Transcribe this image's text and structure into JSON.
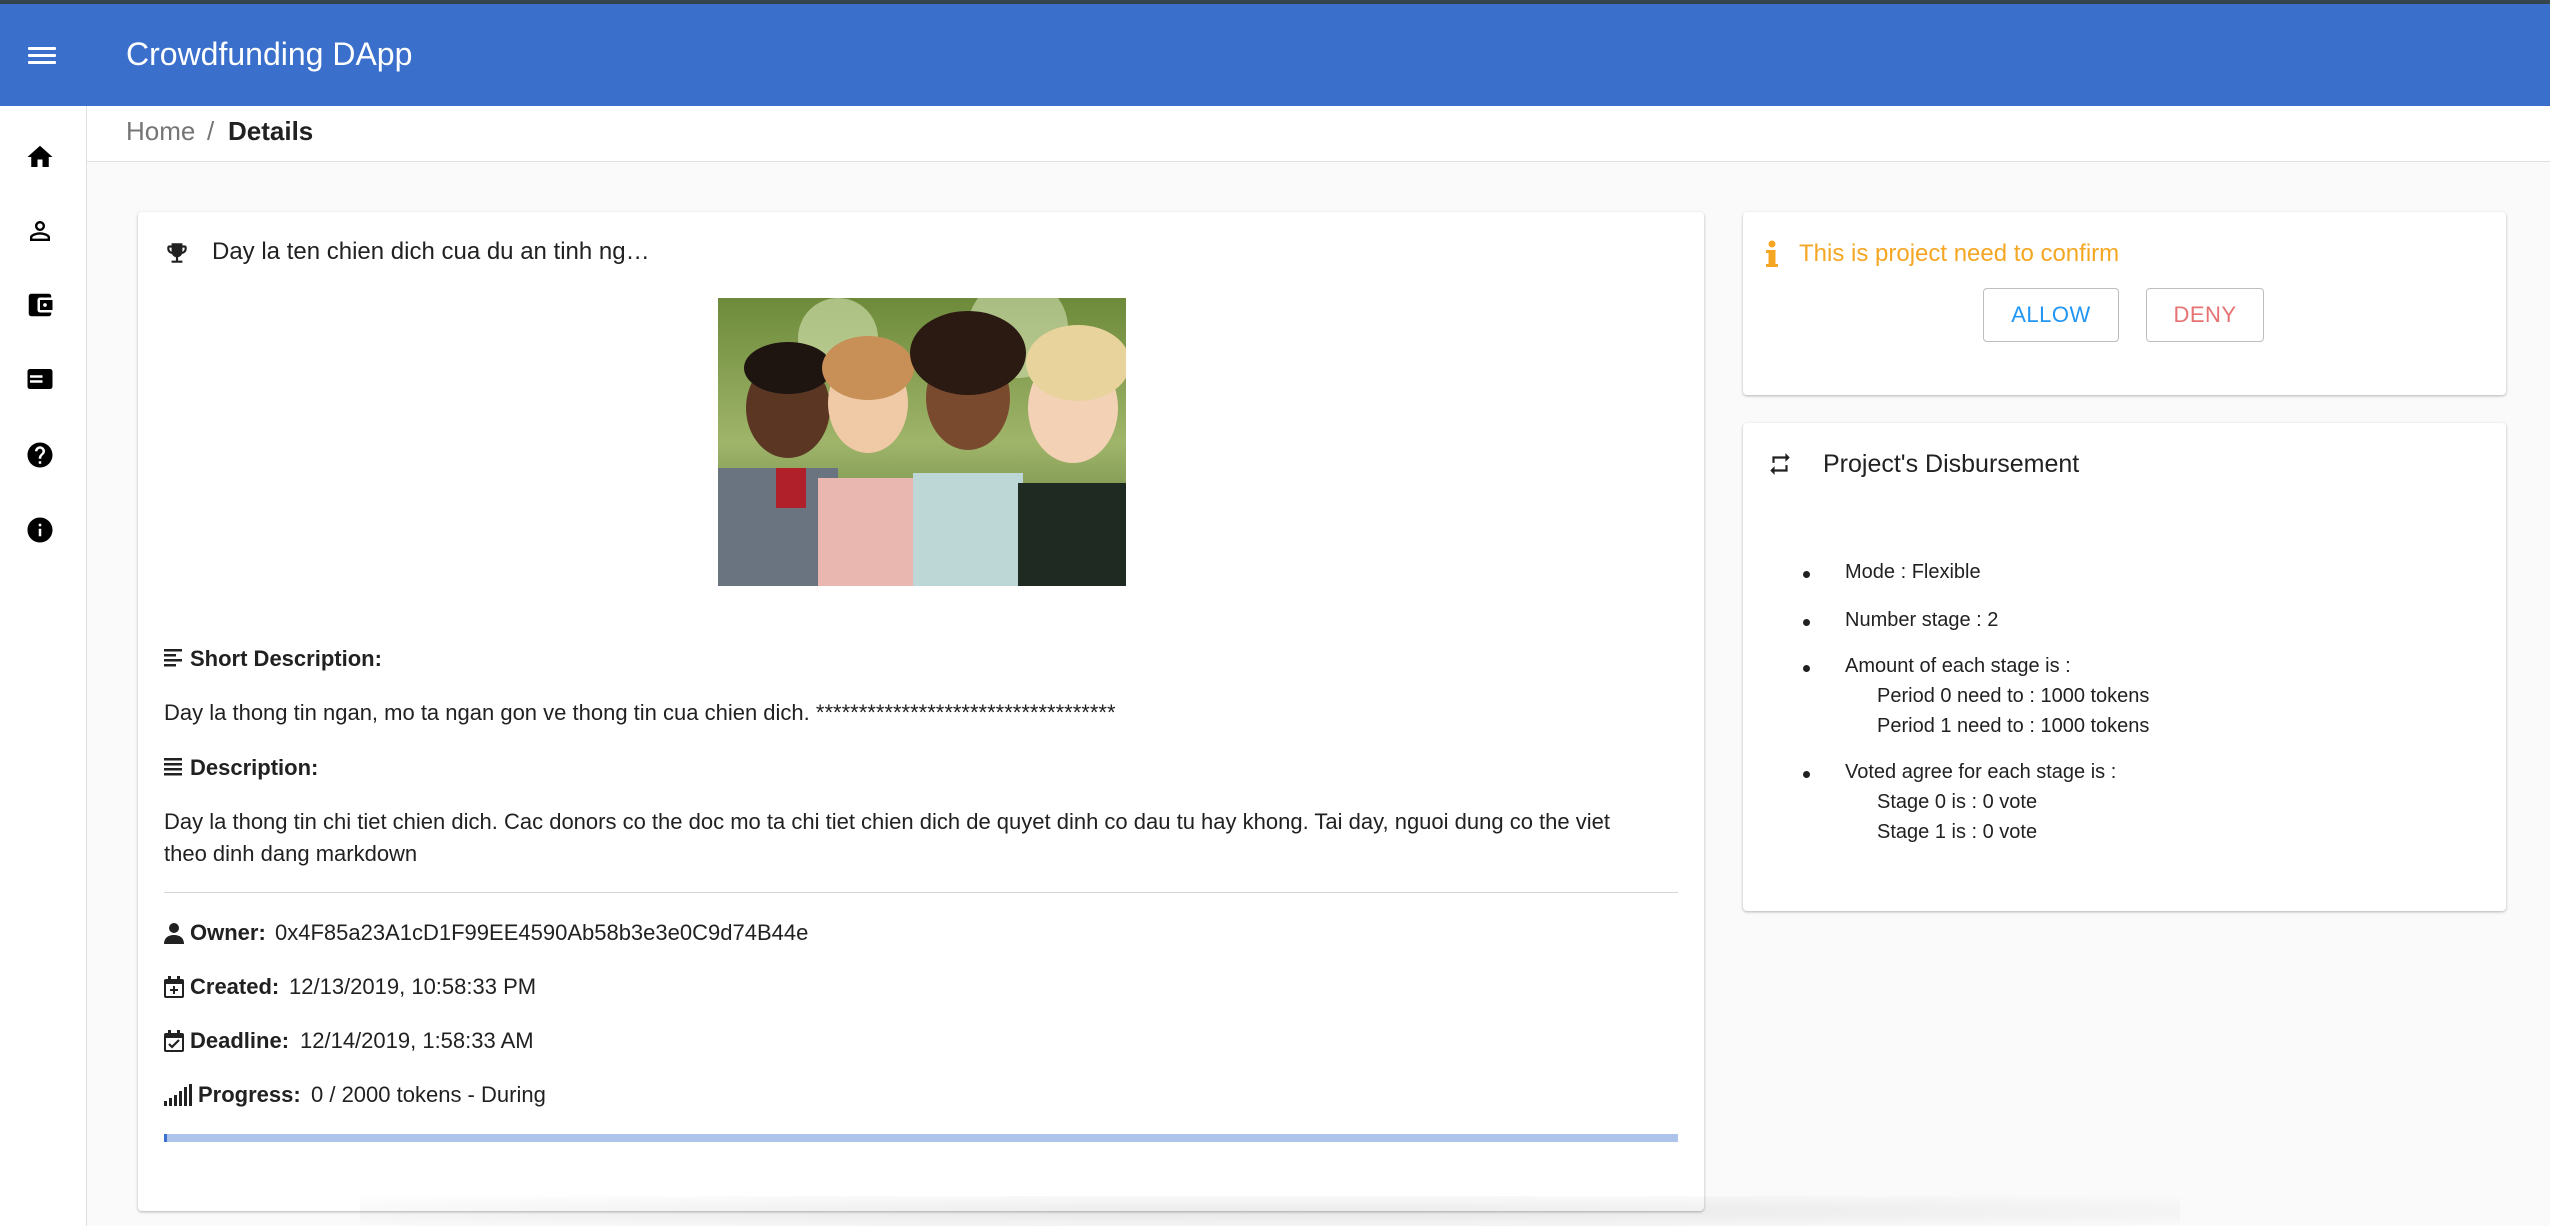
{
  "app": {
    "title": "Crowdfunding DApp"
  },
  "sidebar": {
    "items": [
      {
        "icon": "home-icon"
      },
      {
        "icon": "person-icon"
      },
      {
        "icon": "wallet-icon"
      },
      {
        "icon": "list-icon"
      },
      {
        "icon": "help-icon"
      },
      {
        "icon": "info-icon"
      }
    ]
  },
  "breadcrumb": {
    "home": "Home",
    "separator": "/",
    "current": "Details"
  },
  "campaign": {
    "title": "Day la ten chien dich cua du an tinh ng…",
    "short_description_label": "Short Description:",
    "short_description": "Day la thong tin ngan, mo ta ngan gon ve thong tin cua chien dich. ***********************************",
    "description_label": "Description:",
    "description_line1": "Day la thong tin chi tiet chien dich. Cac donors co the doc mo ta chi tiet chien dich de quyet dinh co dau tu hay khong. Tai day, nguoi dung co the viet",
    "description_line2": "theo dinh dang markdown",
    "owner_label": "Owner:",
    "owner": "0x4F85a23A1cD1F99EE4590Ab58b3e3e0C9d74B44e",
    "created_label": "Created:",
    "created": "12/13/2019, 10:58:33 PM",
    "deadline_label": "Deadline:",
    "deadline": "12/14/2019, 1:58:33 AM",
    "progress_label": "Progress:",
    "progress_text": "0 / 2000 tokens - During",
    "progress_fraction": 0.002
  },
  "confirm": {
    "message": "This is project need to confirm",
    "allow_label": "ALLOW",
    "deny_label": "DENY",
    "warning_color": "#f5a623"
  },
  "disbursement": {
    "title": "Project's Disbursement",
    "mode": "Mode : Flexible",
    "number_stage": "Number stage : 2",
    "amount_heading": "Amount of each stage is :",
    "periods": [
      "Period 0 need to : 1000 tokens",
      "Period 1 need to : 1000 tokens"
    ],
    "votes_heading": "Voted agree for each stage is :",
    "votes": [
      "Stage 0 is : 0 vote",
      "Stage 1 is : 0 vote"
    ]
  },
  "colors": {
    "appbar": "#3a6fcc",
    "allow": "#2196f3",
    "deny": "#e57373",
    "progress_track": "#aec3ea"
  }
}
